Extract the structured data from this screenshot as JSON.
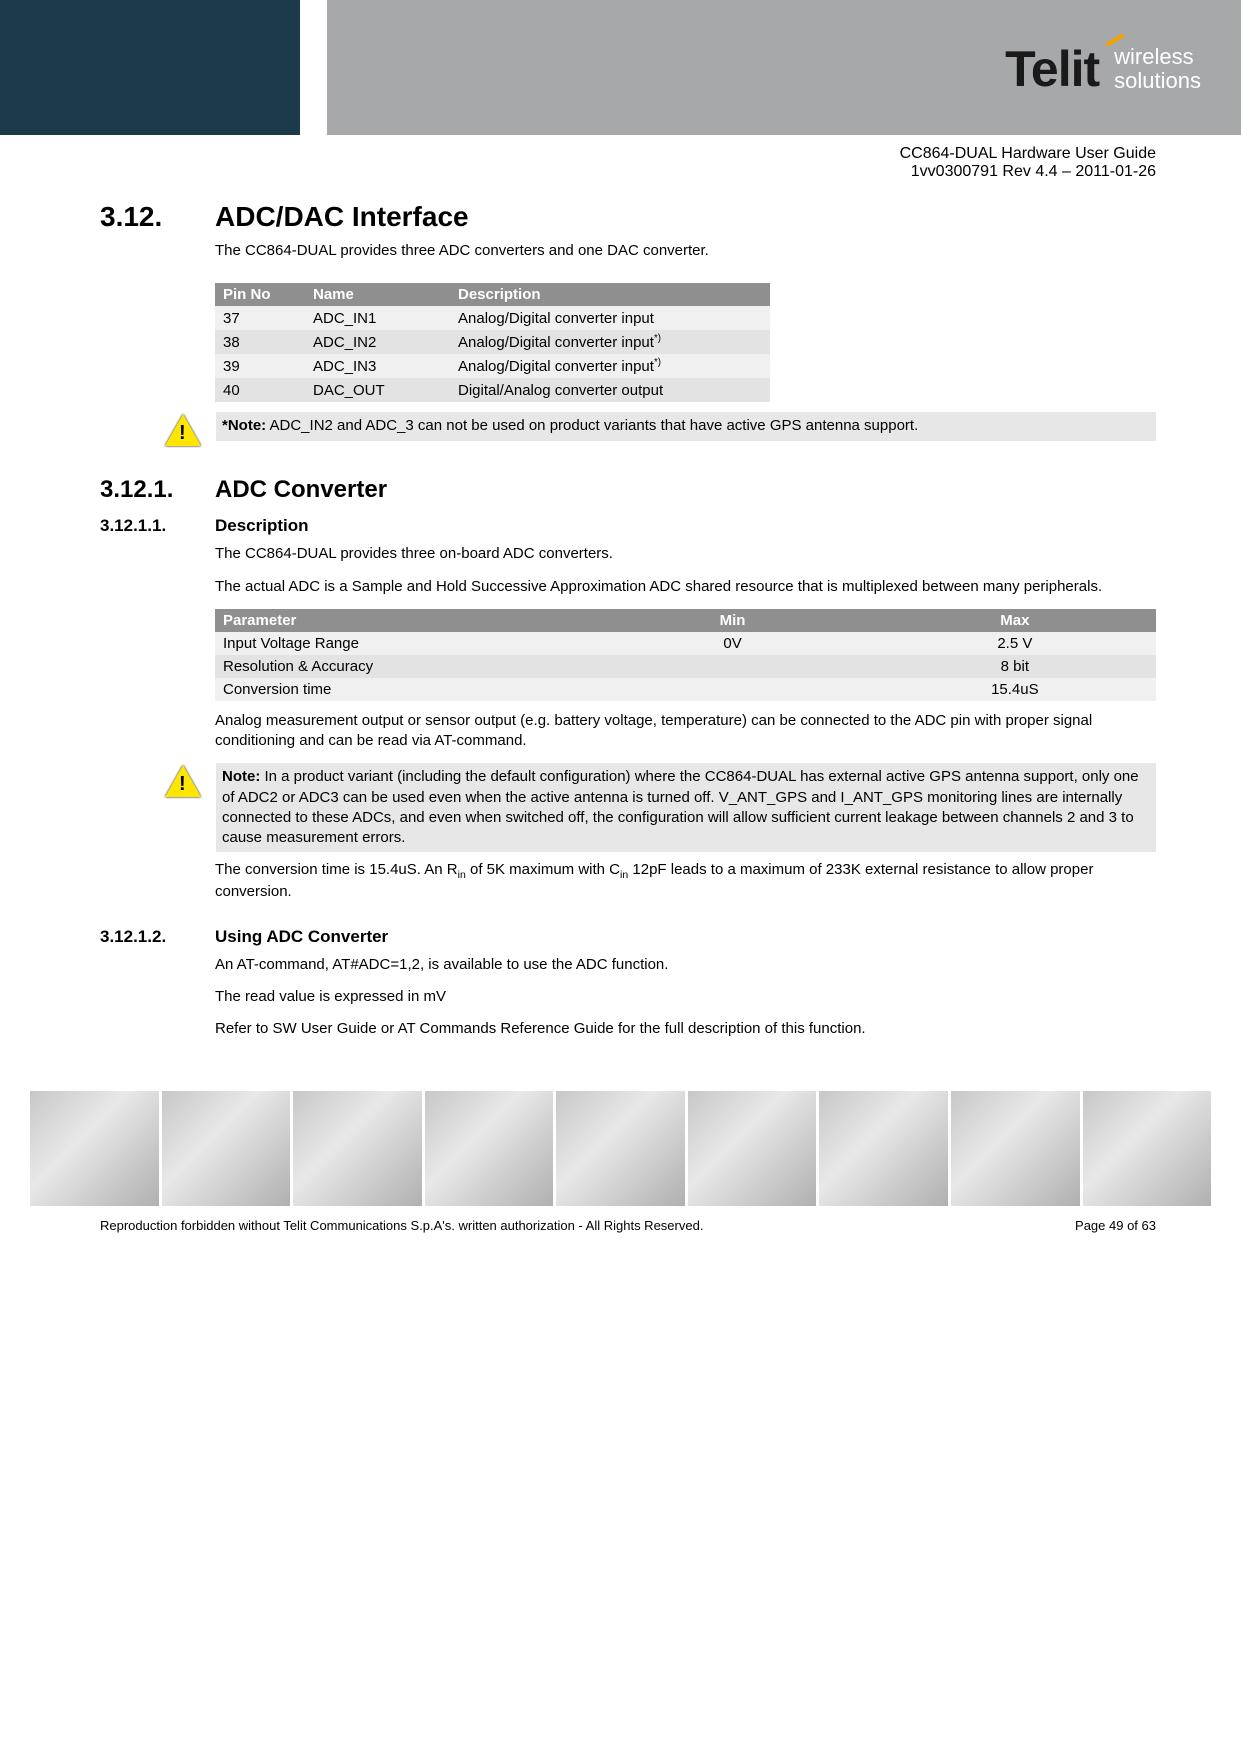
{
  "header": {
    "logo_name": "Telit",
    "logo_tag1": "wireless",
    "logo_tag2": "solutions",
    "doc_title": "CC864-DUAL Hardware User Guide",
    "doc_rev": "1vv0300791 Rev 4.4 – 2011-01-26"
  },
  "sec312": {
    "num": "3.12.",
    "title": "ADC/DAC Interface",
    "intro": "The CC864-DUAL provides three ADC converters and one DAC converter."
  },
  "pin_table": {
    "headers": {
      "c1": "Pin No",
      "c2": "Name",
      "c3": "Description"
    },
    "rows": [
      {
        "pin": "37",
        "name": "ADC_IN1",
        "desc": "Analog/Digital converter input",
        "sup": ""
      },
      {
        "pin": "38",
        "name": "ADC_IN2",
        "desc": "Analog/Digital converter input",
        "sup": "*)"
      },
      {
        "pin": "39",
        "name": "ADC_IN3",
        "desc": "Analog/Digital converter input",
        "sup": "*)"
      },
      {
        "pin": "40",
        "name": "DAC_OUT",
        "desc": "Digital/Analog converter output",
        "sup": ""
      }
    ]
  },
  "note1": {
    "label": "*Note:",
    "text": " ADC_IN2 and ADC_3 can not be used on product variants that have active GPS antenna support."
  },
  "sec3121": {
    "num": "3.12.1.",
    "title": "ADC Converter"
  },
  "sec31211": {
    "num": "3.12.1.1.",
    "title": "Description",
    "p1": "The CC864-DUAL provides three on-board ADC converters.",
    "p2": "The actual ADC is a Sample and Hold Successive Approximation ADC shared resource that is multiplexed between many peripherals."
  },
  "param_table": {
    "headers": {
      "c1": "Parameter",
      "c2": "Min",
      "c3": "Max"
    },
    "rows": [
      {
        "p": "Input Voltage Range",
        "min": "0V",
        "max": "2.5 V"
      },
      {
        "p": "Resolution & Accuracy",
        "min": "",
        "max": "8 bit"
      },
      {
        "p": "Conversion time",
        "min": "",
        "max": "15.4uS"
      }
    ]
  },
  "p_after_param": "Analog measurement output or sensor output (e.g. battery voltage, temperature) can be connected to the ADC pin with proper signal conditioning and can be read via AT-command.",
  "note2": {
    "label": "Note:",
    "text": " In a product variant (including the default configuration) where the CC864-DUAL has external active GPS antenna support, only one of ADC2 or ADC3 can be used even when the active antenna is turned off. V_ANT_GPS and I_ANT_GPS monitoring lines are internally connected to these ADCs, and even when switched off, the configuration will allow sufficient current leakage between channels 2 and 3 to cause measurement errors."
  },
  "conv_time": {
    "pre": "The conversion time is 15.4uS.  An  R",
    "sub1": "in",
    "mid": " of 5K maximum with C",
    "sub2": "in",
    "post": " 12pF leads to a maximum of 233K external resistance to allow proper conversion."
  },
  "sec31212": {
    "num": "3.12.1.2.",
    "title": "Using ADC Converter",
    "p1": "An AT-command, AT#ADC=1,2, is available to use the ADC function.",
    "p2": "The read value is expressed in mV",
    "p3": "Refer to SW User Guide or AT Commands Reference Guide for the full description of this function."
  },
  "footer": {
    "copyright": "Reproduction forbidden without Telit Communications S.p.A's. written authorization - All Rights Reserved.",
    "page": "Page 49 of 63"
  }
}
